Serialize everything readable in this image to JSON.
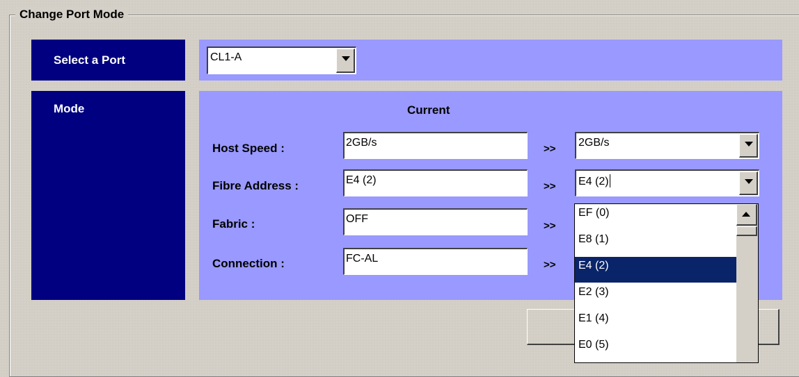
{
  "group": {
    "title": "Change Port Mode"
  },
  "select_port": {
    "label": "Select a Port",
    "value": "CL1-A"
  },
  "mode": {
    "label": "Mode",
    "current_header": "Current",
    "rows": [
      {
        "label": "Host Speed :",
        "current": "2GB/s",
        "arrow": ">>",
        "new": "2GB/s"
      },
      {
        "label": "Fibre Address :",
        "current": "E4 (2)",
        "arrow": ">>",
        "new": "E4 (2)"
      },
      {
        "label": "Fabric :",
        "current": "OFF",
        "arrow": ">>"
      },
      {
        "label": "Connection :",
        "current": "FC-AL",
        "arrow": ">>"
      }
    ]
  },
  "fibre_dropdown": {
    "options": [
      "EF (0)",
      "E8 (1)",
      "E4 (2)",
      "E2 (3)",
      "E1 (4)",
      "E0 (5)"
    ],
    "selected": "E4 (2)"
  },
  "colors": {
    "label_bg": "#000080",
    "panel_bg": "#9999ff",
    "selection": "#0a246a",
    "window_bg": "#d4d0c8"
  }
}
